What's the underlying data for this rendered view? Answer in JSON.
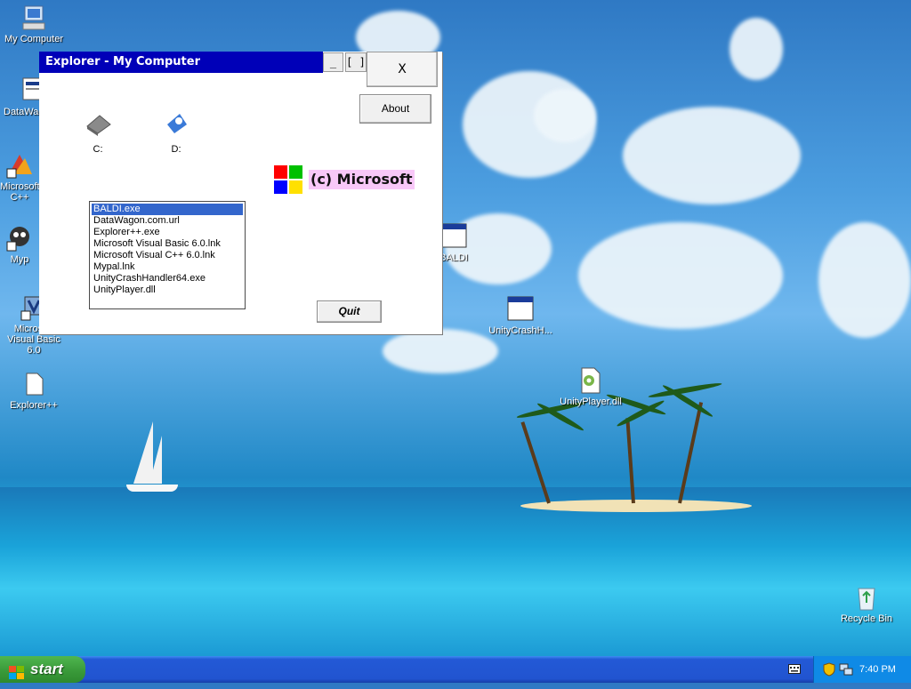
{
  "desktop": {
    "icons": [
      {
        "label": "My Computer"
      },
      {
        "label": "DataWag"
      },
      {
        "label": "Microsoft C++"
      },
      {
        "label": "Myp"
      },
      {
        "label": "Microsoft Visual Basic 6.0"
      },
      {
        "label": "Explorer++"
      },
      {
        "label": "BALDI"
      },
      {
        "label": "UnityCrashH..."
      },
      {
        "label": "UnityPlayer.dll"
      },
      {
        "label": "Recycle Bin"
      }
    ]
  },
  "window": {
    "title": "Explorer - My Computer",
    "minimize_label": "_",
    "maximize_label": "[ ]",
    "close_label": "X",
    "about_label": "About",
    "quit_label": "Quit",
    "drives": [
      {
        "label": "C:",
        "icon": "hard-drive-icon"
      },
      {
        "label": "D:",
        "icon": "cd-drive-icon"
      }
    ],
    "files": [
      "BALDI.exe",
      "DataWagon.com.url",
      "Explorer++.exe",
      "Microsoft Visual Basic 6.0.lnk",
      "Microsoft Visual C++ 6.0.lnk",
      "Mypal.lnk",
      "UnityCrashHandler64.exe",
      "UnityPlayer.dll"
    ],
    "selected_file": "BALDI.exe",
    "brand_text": "(c) Microsoft",
    "logo_colors": [
      "#ff0000",
      "#00c000",
      "#0000ff",
      "#ffe000"
    ]
  },
  "taskbar": {
    "start_label": "start",
    "clock": "7:40 PM",
    "accent": "#2154d0"
  }
}
